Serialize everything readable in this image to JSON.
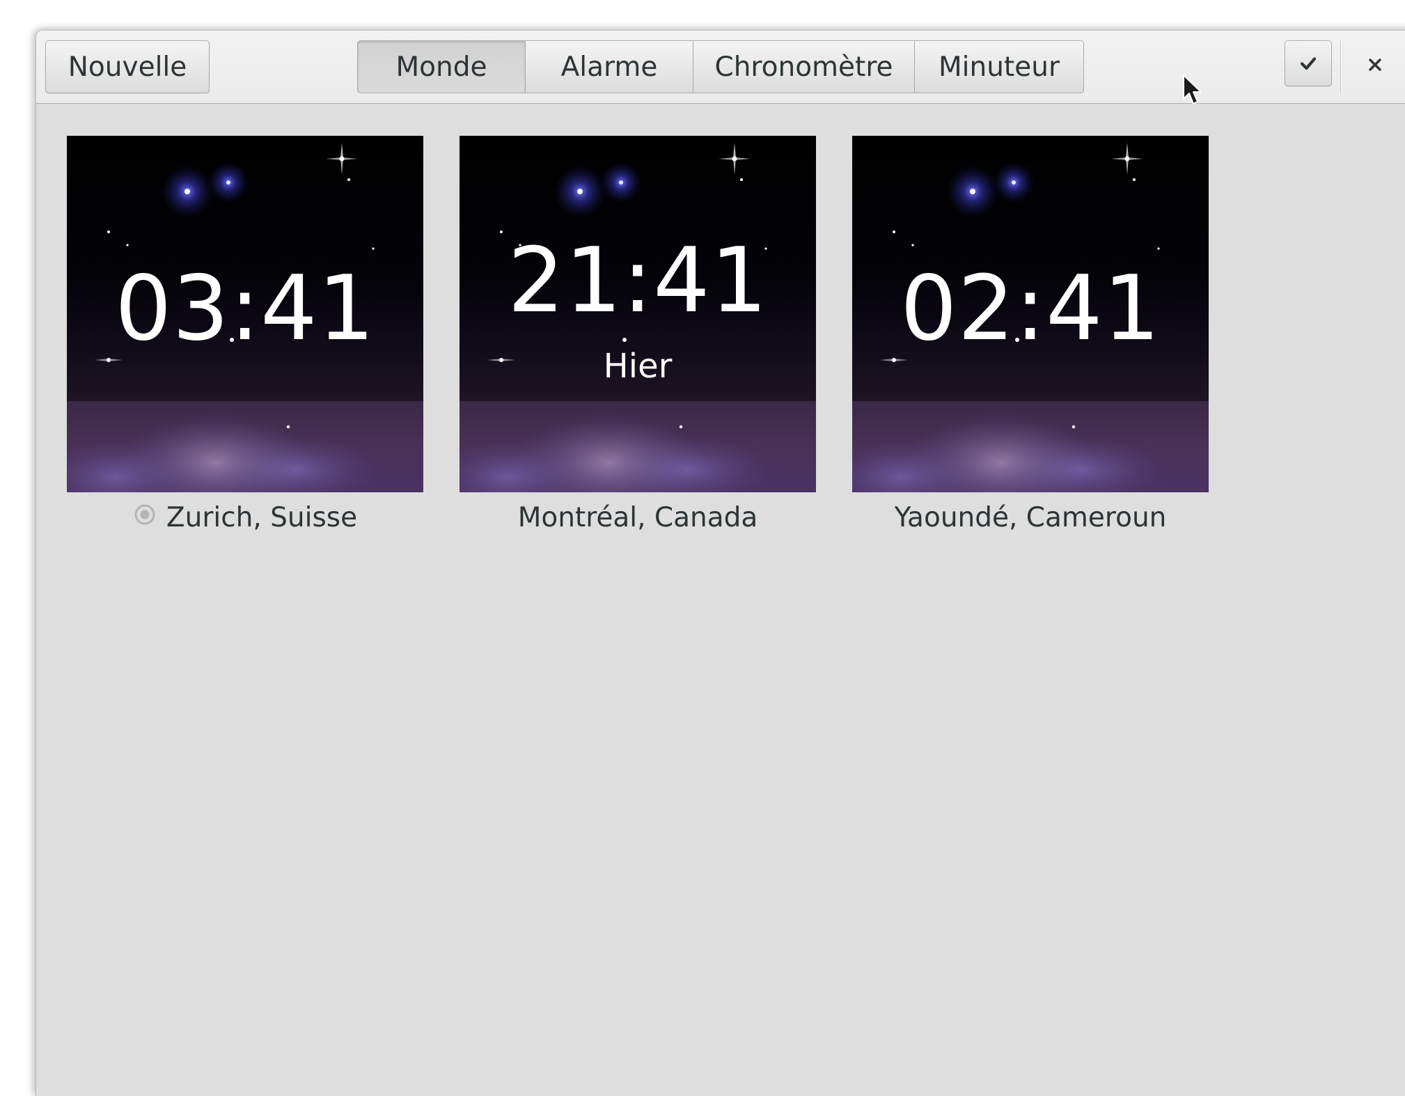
{
  "header": {
    "new_button_label": "Nouvelle",
    "tabs": [
      {
        "label": "Monde",
        "active": true
      },
      {
        "label": "Alarme",
        "active": false
      },
      {
        "label": "Chronomètre",
        "active": false
      },
      {
        "label": "Minuteur",
        "active": false
      }
    ],
    "select_icon": "checkmark-icon",
    "close_icon": "close-icon"
  },
  "clocks": [
    {
      "time": "03:41",
      "day": "",
      "location": "Zurich, Suisse",
      "current_location": true,
      "location_icon": "location-icon"
    },
    {
      "time": "21:41",
      "day": "Hier",
      "location": "Montréal, Canada",
      "current_location": false
    },
    {
      "time": "02:41",
      "day": "",
      "location": "Yaoundé, Cameroun",
      "current_location": false
    }
  ],
  "colors": {
    "window_background": "#dedede",
    "headerbar_background": "#efefef",
    "text": "#2e3436",
    "night_sky_top": "#000000",
    "night_horizon": "#4a3158",
    "clock_text": "#ffffff"
  }
}
